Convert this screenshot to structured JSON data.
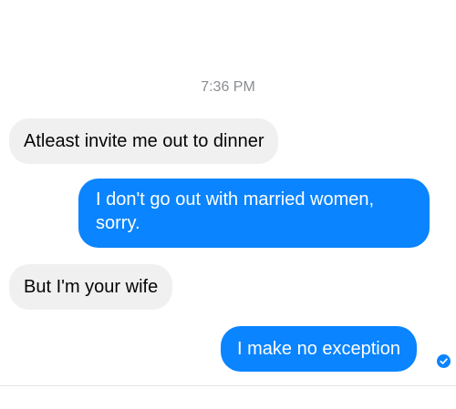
{
  "conversation": {
    "timestamp": "7:36 PM",
    "messages": [
      {
        "direction": "incoming",
        "text": "Atleast invite me out to dinner"
      },
      {
        "direction": "outgoing",
        "text": "I don't go out with married women, sorry."
      },
      {
        "direction": "incoming",
        "text": "But I'm your wife"
      },
      {
        "direction": "outgoing",
        "text": "I make no exception"
      }
    ],
    "read_receipt_icon": "check-circle-icon"
  },
  "colors": {
    "outgoing_bubble": "#0a84ff",
    "incoming_bubble": "#f0f0f0",
    "timestamp_text": "#8a8d91"
  }
}
